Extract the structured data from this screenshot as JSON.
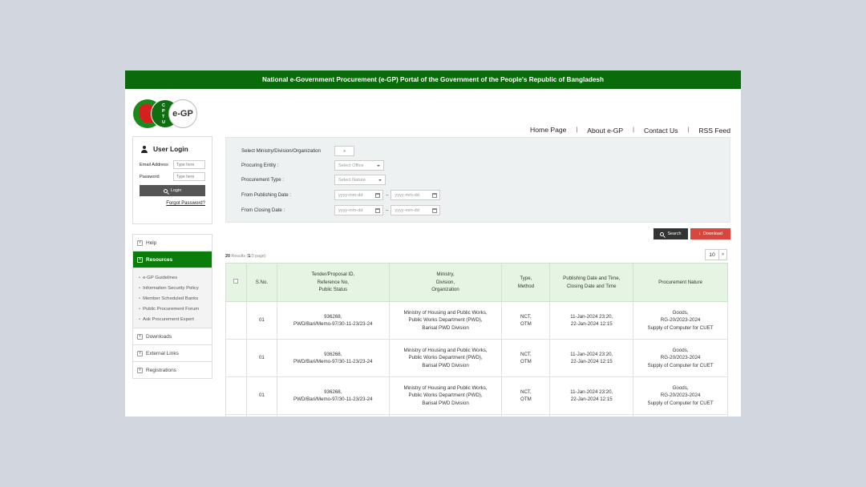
{
  "banner": "National e-Government Procurement (e-GP) Portal of the Government of the People's Republic of Bangladesh",
  "logo": {
    "cptu_letters": [
      "C",
      "P",
      "T",
      "U"
    ],
    "egp_text": "e-GP"
  },
  "nav": [
    "Home Page",
    "About e-GP",
    "Contact Us",
    "RSS Feed"
  ],
  "login": {
    "title": "User Login",
    "email_label": "Email Address",
    "email_placeholder": "Type here",
    "password_label": "Password",
    "password_placeholder": "Type here",
    "button": "Login",
    "forgot": "Forgot Password?"
  },
  "menu": {
    "help": "Help",
    "resources": "Resources",
    "resources_items": [
      "e-GP Guidelines",
      "Information Security Policy",
      "Member Scheduled Banks",
      "Public Procurement Forum",
      "Ask Procurement Expert"
    ],
    "downloads": "Downloads",
    "external_links": "External Links",
    "registrations": "Registrations"
  },
  "search": {
    "ministry_label": "Select Ministry/Division/Organization",
    "ministry_btn": "»",
    "entity_label": "Procuring Entity :",
    "entity_value": "Select Office",
    "type_label": "Procurement Type :",
    "type_value": "Select Nature",
    "pub_label": "From Publishing Date :",
    "close_label": "From Closing Date :",
    "date_placeholder": "yyyy-mm-dd",
    "dash": "–"
  },
  "actions": {
    "search": "Search",
    "download": "Download"
  },
  "results": {
    "count": "20",
    "label_a": "Results (",
    "page": "1",
    "label_b": "/3 page)"
  },
  "page_size": {
    "value": "10",
    "next": "»"
  },
  "table": {
    "headers": {
      "sno": "S.No.",
      "tender": [
        "Tender/Proposal ID,",
        "Reference No,",
        "Public Status"
      ],
      "ministry": [
        "Ministry,",
        "Division,",
        "Organization"
      ],
      "type": [
        "Type,",
        "Method"
      ],
      "dates": [
        "Publishing Date and Time,",
        "Closing Date and Time"
      ],
      "nature": "Procurement Nature"
    },
    "rows": [
      {
        "sno": "01",
        "id": "936268,",
        "ref": "PWD/Bari/Memo-97/30-11-23/23-24",
        "min1": "Ministry of Housing and Public Works,",
        "min2": "Public Works Department (PWD),",
        "min3": "Barisal PWD Division",
        "type": "NCT,",
        "method": "OTM",
        "pub": "11-Jan-2024 23:20,",
        "close": "22-Jan-2024 12:15",
        "nat1": "Goods,",
        "nat2": "RG-20/2023-2024",
        "nat3": "Supply of Computer for CUET"
      },
      {
        "sno": "01",
        "id": "936268,",
        "ref": "PWD/Bari/Memo-97/30-11-23/23-24",
        "min1": "Ministry of Housing and Public Works,",
        "min2": "Public Works Department (PWD),",
        "min3": "Barisal PWD Division",
        "type": "NCT,",
        "method": "OTM",
        "pub": "11-Jan-2024 23:20,",
        "close": "22-Jan-2024 12:15",
        "nat1": "Goods,",
        "nat2": "RG-20/2023-2024",
        "nat3": "Supply of Computer for CUET"
      },
      {
        "sno": "01",
        "id": "936268,",
        "ref": "PWD/Bari/Memo-97/30-11-23/23-24",
        "min1": "Ministry of Housing and Public Works,",
        "min2": "Public Works Department (PWD),",
        "min3": "Barisal PWD Division",
        "type": "NCT,",
        "method": "OTM",
        "pub": "11-Jan-2024 23:20,",
        "close": "22-Jan-2024 12:15",
        "nat1": "Goods,",
        "nat2": "RG-20/2023-2024",
        "nat3": "Supply of Computer for CUET"
      }
    ]
  },
  "colors": {
    "brand_green": "#0a6b0a",
    "menu_active": "#0a7d0a",
    "header_bg": "#e6f5e3",
    "download": "#d9463e"
  }
}
